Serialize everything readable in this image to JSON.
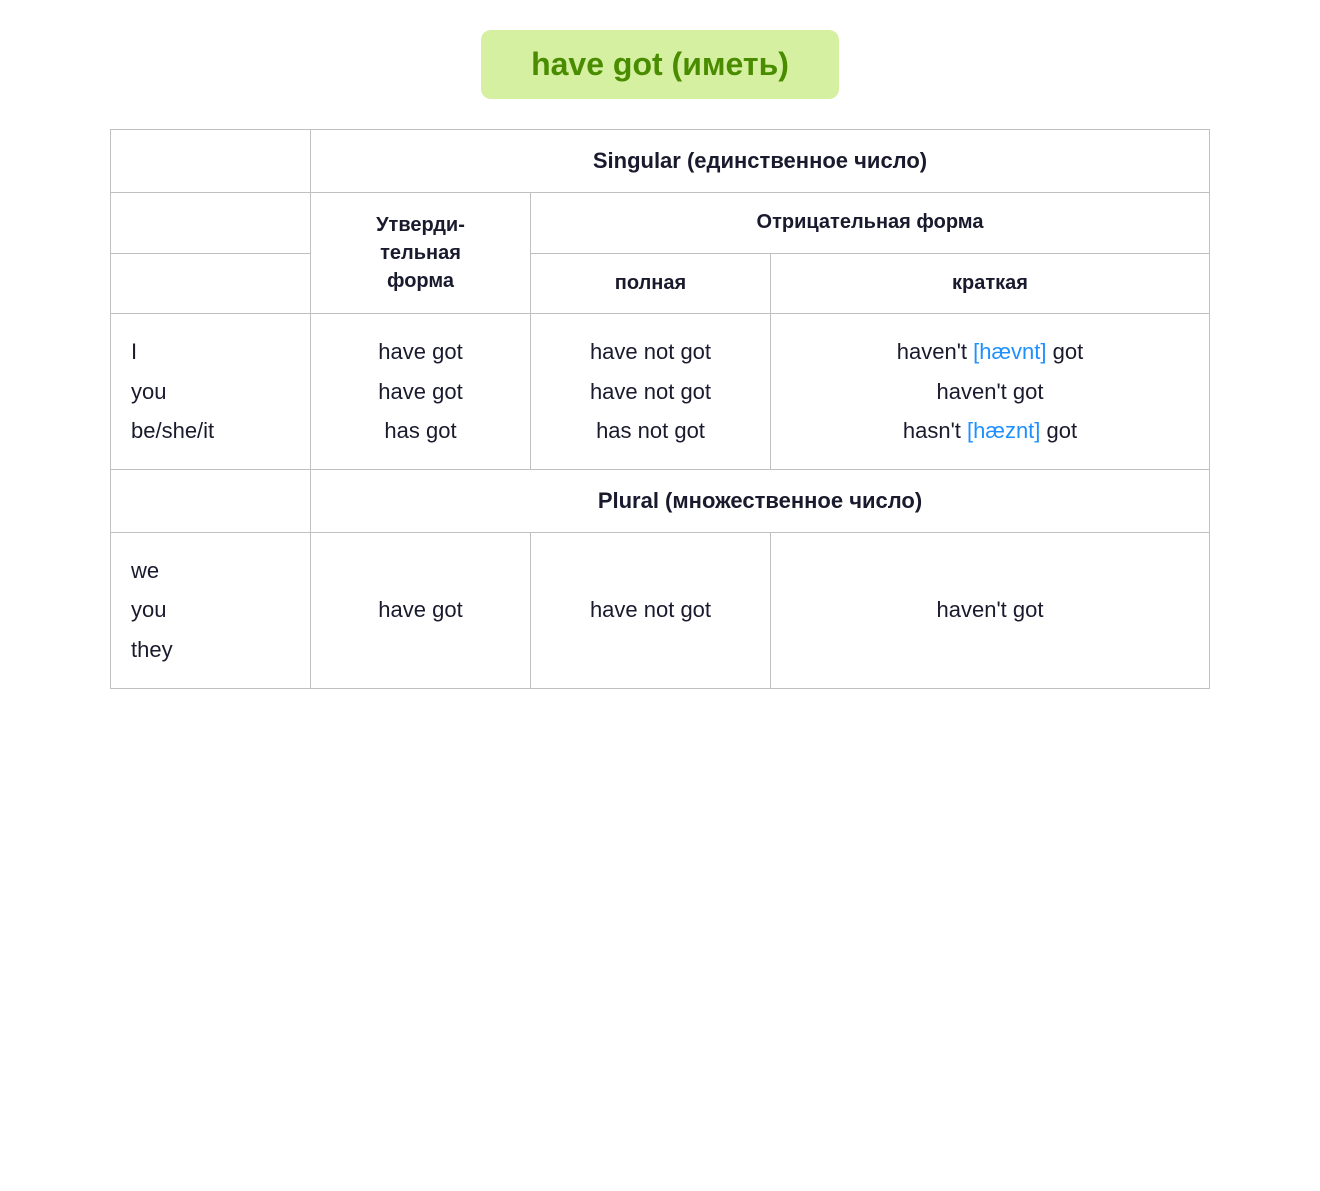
{
  "title": "have got (иметь)",
  "title_bg": "#d4f0a0",
  "title_color": "#4a8c00",
  "singular_label": "Singular (единственное число)",
  "plural_label": "Plural (множественное число)",
  "affirmative_header": "Утверди-тельная форма",
  "negative_header": "Отрицательная форма",
  "negative_full_subheader": "полная",
  "negative_short_subheader": "краткая",
  "singular": {
    "pronouns": [
      "I",
      "you",
      "be/she/it"
    ],
    "affirmative": [
      "have got",
      "have got",
      "has got"
    ],
    "negative_full": [
      "have not got",
      "have not got",
      "has not got"
    ],
    "negative_short_parts": [
      {
        "pre": "haven't ",
        "phonetic": "[hævnt]",
        "post": " got"
      },
      {
        "pre": "haven't got",
        "phonetic": "",
        "post": ""
      },
      {
        "pre": "hasn't ",
        "phonetic": "[hæznt]",
        "post": " got"
      }
    ]
  },
  "plural": {
    "pronouns": [
      "we",
      "you",
      "they"
    ],
    "affirmative": "have got",
    "negative_full": "have not got",
    "negative_short": "haven't got"
  }
}
